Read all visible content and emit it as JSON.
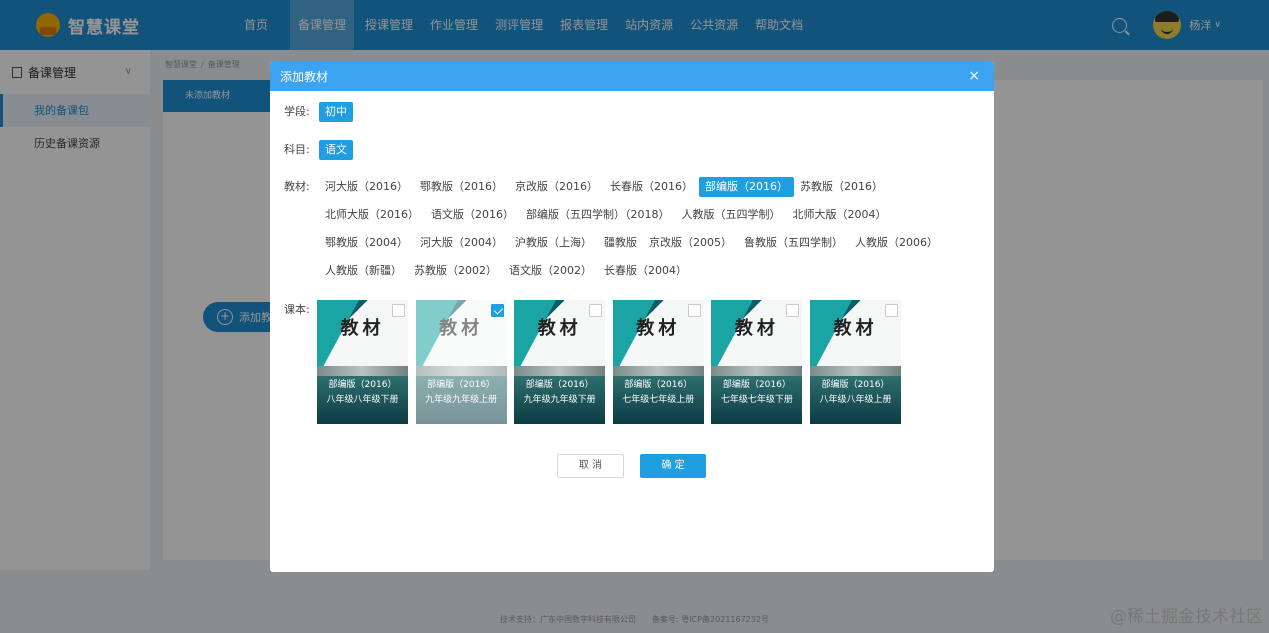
{
  "app": {
    "name": "智慧课堂"
  },
  "nav": {
    "items": [
      "首页",
      "备课管理",
      "授课管理",
      "作业管理",
      "测评管理",
      "报表管理",
      "站内资源",
      "公共资源",
      "帮助文档"
    ],
    "active_index": 1
  },
  "user": {
    "name": "杨洋",
    "caret": "∨"
  },
  "sidebar": {
    "header": "备课管理",
    "chevron": "∨",
    "items": [
      "我的备课包",
      "历史备课资源"
    ]
  },
  "breadcrumb": [
    "智慧课堂",
    "备课管理"
  ],
  "main": {
    "tab_label": "未添加教材",
    "add_button": "添加教材"
  },
  "footer": {
    "text": "技术支持：广东中国数字科技有限公司　　备案号: 粤ICP备2021167232号"
  },
  "watermark": "@稀土掘金技术社区",
  "modal": {
    "title": "添加教材",
    "close": "×",
    "stage_label": "学段:",
    "stage_value": "初中",
    "subject_label": "科目:",
    "subject_value": "语文",
    "textbook_label": "教材:",
    "textbooks": [
      "河大版（2016）",
      "鄂教版（2016）",
      "京改版（2016）",
      "长春版（2016）",
      "部编版（2016）",
      "苏教版（2016）",
      "北师大版（2016）",
      "语文版（2016）",
      "部编版（五四学制）（2018）",
      "人教版（五四学制）",
      "北师大版（2004）",
      "鄂教版（2004）",
      "河大版（2004）",
      "沪教版（上海）",
      "疆教版",
      "京改版（2005）",
      "鲁教版（五四学制）",
      "人教版（2006）",
      "人教版（新疆）",
      "苏教版（2002）",
      "语文版（2002）",
      "长春版（2004）"
    ],
    "textbook_selected_index": 4,
    "books_label": "课本:",
    "books": [
      {
        "cover": "教材",
        "edition": "部编版（2016）",
        "volume": "八年级八年级下册",
        "checked": false
      },
      {
        "cover": "教材",
        "edition": "部编版（2016）",
        "volume": "九年级九年级上册",
        "checked": true
      },
      {
        "cover": "教材",
        "edition": "部编版（2016）",
        "volume": "九年级九年级下册",
        "checked": false
      },
      {
        "cover": "教材",
        "edition": "部编版（2016）",
        "volume": "七年级七年级上册",
        "checked": false
      },
      {
        "cover": "教材",
        "edition": "部编版（2016）",
        "volume": "七年级七年级下册",
        "checked": false
      },
      {
        "cover": "教材",
        "edition": "部编版（2016）",
        "volume": "八年级八年级上册",
        "checked": false
      }
    ],
    "cancel_label": "取 消",
    "ok_label": "确 定"
  },
  "colors": {
    "primary": "#1f8fd6",
    "modal_header": "#3ba3ef",
    "selected_chip": "#1f9ee0"
  }
}
